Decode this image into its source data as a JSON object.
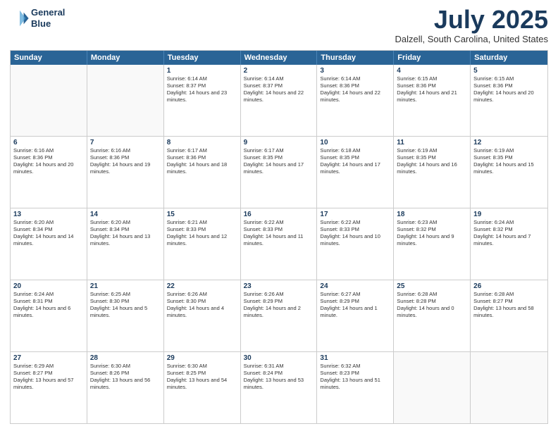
{
  "logo": {
    "line1": "General",
    "line2": "Blue"
  },
  "title": "July 2025",
  "subtitle": "Dalzell, South Carolina, United States",
  "header_days": [
    "Sunday",
    "Monday",
    "Tuesday",
    "Wednesday",
    "Thursday",
    "Friday",
    "Saturday"
  ],
  "weeks": [
    [
      {
        "date": "",
        "text": ""
      },
      {
        "date": "",
        "text": ""
      },
      {
        "date": "1",
        "text": "Sunrise: 6:14 AM\nSunset: 8:37 PM\nDaylight: 14 hours and 23 minutes."
      },
      {
        "date": "2",
        "text": "Sunrise: 6:14 AM\nSunset: 8:37 PM\nDaylight: 14 hours and 22 minutes."
      },
      {
        "date": "3",
        "text": "Sunrise: 6:14 AM\nSunset: 8:36 PM\nDaylight: 14 hours and 22 minutes."
      },
      {
        "date": "4",
        "text": "Sunrise: 6:15 AM\nSunset: 8:36 PM\nDaylight: 14 hours and 21 minutes."
      },
      {
        "date": "5",
        "text": "Sunrise: 6:15 AM\nSunset: 8:36 PM\nDaylight: 14 hours and 20 minutes."
      }
    ],
    [
      {
        "date": "6",
        "text": "Sunrise: 6:16 AM\nSunset: 8:36 PM\nDaylight: 14 hours and 20 minutes."
      },
      {
        "date": "7",
        "text": "Sunrise: 6:16 AM\nSunset: 8:36 PM\nDaylight: 14 hours and 19 minutes."
      },
      {
        "date": "8",
        "text": "Sunrise: 6:17 AM\nSunset: 8:36 PM\nDaylight: 14 hours and 18 minutes."
      },
      {
        "date": "9",
        "text": "Sunrise: 6:17 AM\nSunset: 8:35 PM\nDaylight: 14 hours and 17 minutes."
      },
      {
        "date": "10",
        "text": "Sunrise: 6:18 AM\nSunset: 8:35 PM\nDaylight: 14 hours and 17 minutes."
      },
      {
        "date": "11",
        "text": "Sunrise: 6:19 AM\nSunset: 8:35 PM\nDaylight: 14 hours and 16 minutes."
      },
      {
        "date": "12",
        "text": "Sunrise: 6:19 AM\nSunset: 8:35 PM\nDaylight: 14 hours and 15 minutes."
      }
    ],
    [
      {
        "date": "13",
        "text": "Sunrise: 6:20 AM\nSunset: 8:34 PM\nDaylight: 14 hours and 14 minutes."
      },
      {
        "date": "14",
        "text": "Sunrise: 6:20 AM\nSunset: 8:34 PM\nDaylight: 14 hours and 13 minutes."
      },
      {
        "date": "15",
        "text": "Sunrise: 6:21 AM\nSunset: 8:33 PM\nDaylight: 14 hours and 12 minutes."
      },
      {
        "date": "16",
        "text": "Sunrise: 6:22 AM\nSunset: 8:33 PM\nDaylight: 14 hours and 11 minutes."
      },
      {
        "date": "17",
        "text": "Sunrise: 6:22 AM\nSunset: 8:33 PM\nDaylight: 14 hours and 10 minutes."
      },
      {
        "date": "18",
        "text": "Sunrise: 6:23 AM\nSunset: 8:32 PM\nDaylight: 14 hours and 9 minutes."
      },
      {
        "date": "19",
        "text": "Sunrise: 6:24 AM\nSunset: 8:32 PM\nDaylight: 14 hours and 7 minutes."
      }
    ],
    [
      {
        "date": "20",
        "text": "Sunrise: 6:24 AM\nSunset: 8:31 PM\nDaylight: 14 hours and 6 minutes."
      },
      {
        "date": "21",
        "text": "Sunrise: 6:25 AM\nSunset: 8:30 PM\nDaylight: 14 hours and 5 minutes."
      },
      {
        "date": "22",
        "text": "Sunrise: 6:26 AM\nSunset: 8:30 PM\nDaylight: 14 hours and 4 minutes."
      },
      {
        "date": "23",
        "text": "Sunrise: 6:26 AM\nSunset: 8:29 PM\nDaylight: 14 hours and 2 minutes."
      },
      {
        "date": "24",
        "text": "Sunrise: 6:27 AM\nSunset: 8:29 PM\nDaylight: 14 hours and 1 minute."
      },
      {
        "date": "25",
        "text": "Sunrise: 6:28 AM\nSunset: 8:28 PM\nDaylight: 14 hours and 0 minutes."
      },
      {
        "date": "26",
        "text": "Sunrise: 6:28 AM\nSunset: 8:27 PM\nDaylight: 13 hours and 58 minutes."
      }
    ],
    [
      {
        "date": "27",
        "text": "Sunrise: 6:29 AM\nSunset: 8:27 PM\nDaylight: 13 hours and 57 minutes."
      },
      {
        "date": "28",
        "text": "Sunrise: 6:30 AM\nSunset: 8:26 PM\nDaylight: 13 hours and 56 minutes."
      },
      {
        "date": "29",
        "text": "Sunrise: 6:30 AM\nSunset: 8:25 PM\nDaylight: 13 hours and 54 minutes."
      },
      {
        "date": "30",
        "text": "Sunrise: 6:31 AM\nSunset: 8:24 PM\nDaylight: 13 hours and 53 minutes."
      },
      {
        "date": "31",
        "text": "Sunrise: 6:32 AM\nSunset: 8:23 PM\nDaylight: 13 hours and 51 minutes."
      },
      {
        "date": "",
        "text": ""
      },
      {
        "date": "",
        "text": ""
      }
    ]
  ]
}
